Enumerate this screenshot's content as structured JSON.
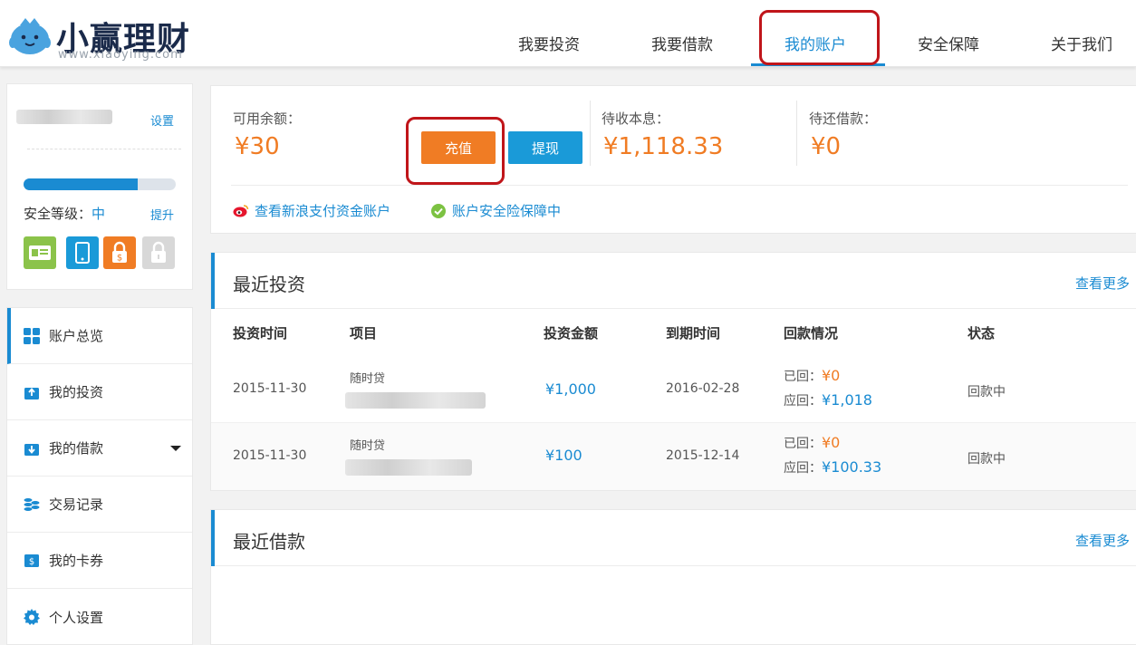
{
  "brand": {
    "name": "小赢理财",
    "url": "www.xiaoying.com"
  },
  "nav": {
    "items": [
      {
        "label": "我要投资"
      },
      {
        "label": "我要借款"
      },
      {
        "label": "我的账户",
        "active": true
      },
      {
        "label": "安全保障"
      },
      {
        "label": "关于我们"
      }
    ]
  },
  "sidebar": {
    "settings_label": "设置",
    "security": {
      "label": "安全等级：",
      "level": "中",
      "upgrade_label": "提升",
      "progress_fraction": 0.75
    },
    "badges": [
      {
        "icon": "id-card-icon",
        "color": "#8bc34a"
      },
      {
        "icon": "phone-icon",
        "color": "#1a9ad8"
      },
      {
        "icon": "payment-lock-icon",
        "color": "#f07c24"
      },
      {
        "icon": "lock-icon",
        "color": "#d8d8d8"
      }
    ],
    "menu": [
      {
        "label": "账户总览",
        "icon": "grid-icon",
        "active": true
      },
      {
        "label": "我的投资",
        "icon": "invest-icon"
      },
      {
        "label": "我的借款",
        "icon": "loan-icon",
        "has_dropdown": true
      },
      {
        "label": "交易记录",
        "icon": "records-icon"
      },
      {
        "label": "我的卡券",
        "icon": "coupon-icon"
      },
      {
        "label": "个人设置",
        "icon": "gear-icon"
      }
    ]
  },
  "account": {
    "available_label": "可用余额：",
    "available_value": "¥30",
    "recharge_label": "充值",
    "withdraw_label": "提现",
    "receivable_label": "待收本息：",
    "receivable_value": "¥1,118.33",
    "repay_label": "待还借款：",
    "repay_value": "¥0",
    "sina_link": "查看新浪支付资金账户",
    "insurance_link": "账户安全险保障中"
  },
  "recent_investments": {
    "title": "最近投资",
    "more_label": "查看更多",
    "columns": [
      "投资时间",
      "项目",
      "投资金额",
      "到期时间",
      "回款情况",
      "状态"
    ],
    "rows": [
      {
        "time": "2015-11-30",
        "project": "随时贷",
        "amount": "¥1,000",
        "due": "2016-02-28",
        "returned_label": "已回：",
        "returned": "¥0",
        "expected_label": "应回：",
        "expected": "¥1,018",
        "status": "回款中"
      },
      {
        "time": "2015-11-30",
        "project": "随时贷",
        "amount": "¥100",
        "due": "2015-12-14",
        "returned_label": "已回：",
        "returned": "¥0",
        "expected_label": "应回：",
        "expected": "¥100.33",
        "status": "回款中"
      }
    ]
  },
  "recent_loans": {
    "title": "最近借款",
    "more_label": "查看更多"
  },
  "colors": {
    "accent_blue": "#1a8bd2",
    "accent_orange": "#f07c24",
    "highlight_red": "#c0151a"
  }
}
